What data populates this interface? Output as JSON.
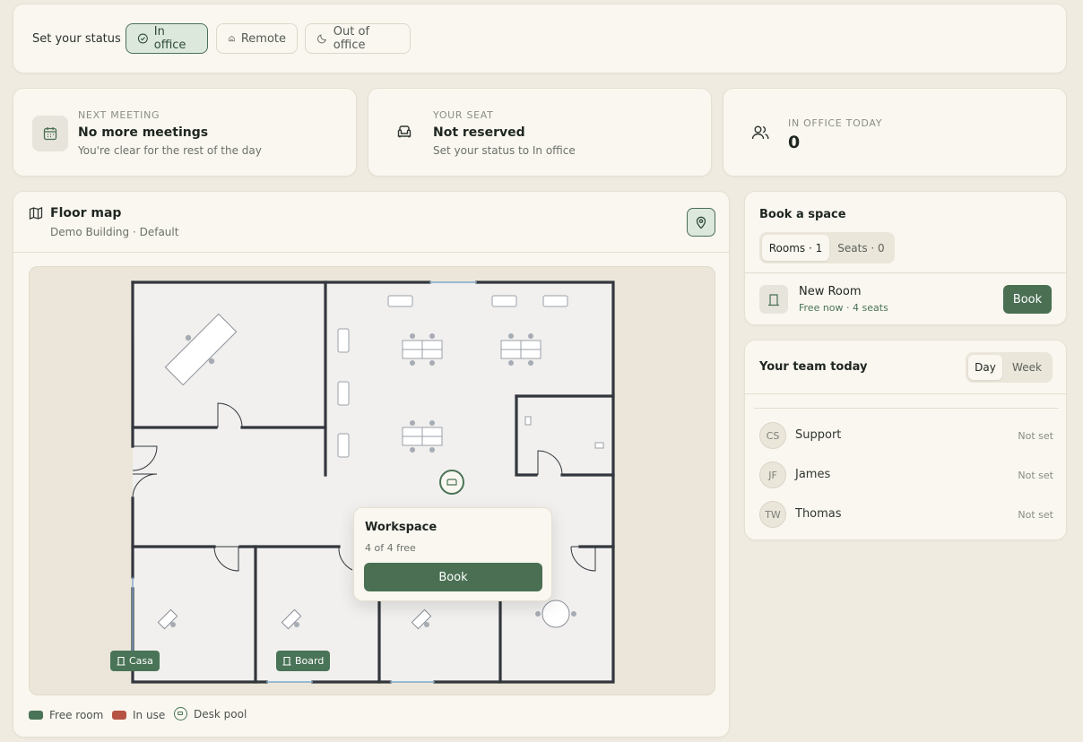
{
  "status": {
    "label": "Set your status",
    "options": [
      {
        "label": "In office",
        "icon": "check-circle-icon",
        "active": true
      },
      {
        "label": "Remote",
        "icon": "home-icon",
        "active": false
      },
      {
        "label": "Out of office",
        "icon": "moon-icon",
        "active": false
      }
    ]
  },
  "cards": {
    "meeting": {
      "kicker": "NEXT MEETING",
      "title": "No more meetings",
      "sub": "You're clear for the rest of the day",
      "icon": "calendar-icon"
    },
    "seat": {
      "kicker": "YOUR SEAT",
      "title": "Not reserved",
      "sub": "Set your status to In office",
      "icon": "armchair-icon"
    },
    "office": {
      "kicker": "IN OFFICE TODAY",
      "count": "0",
      "icon": "users-icon"
    }
  },
  "floor_map": {
    "title": "Floor map",
    "subtitle": "Demo Building · Default",
    "locate_icon": "map-pin-icon",
    "rooms": [
      {
        "name": "Casa",
        "state": "free"
      },
      {
        "name": "Board",
        "state": "free"
      }
    ],
    "popup": {
      "title": "Workspace",
      "availability": "4 of 4 free",
      "button": "Book"
    },
    "legend": [
      {
        "label": "Free room",
        "color": "#4a7457"
      },
      {
        "label": "In use",
        "color": "#b65343"
      },
      {
        "label": "Desk pool",
        "color": "#4a7457"
      }
    ]
  },
  "booking": {
    "title": "Book a space",
    "tabs": [
      {
        "label": "Rooms · 1",
        "active": true
      },
      {
        "label": "Seats · 0",
        "active": false
      }
    ],
    "room": {
      "name": "New Room",
      "detail": "Free now · 4 seats",
      "button": "Book"
    }
  },
  "team": {
    "title": "Your team today",
    "views": [
      {
        "label": "Day",
        "active": true
      },
      {
        "label": "Week",
        "active": false
      }
    ],
    "members": [
      {
        "initials": "CS",
        "name": "Support",
        "status": "Not set"
      },
      {
        "initials": "JF",
        "name": "James",
        "status": "Not set"
      },
      {
        "initials": "TW",
        "name": "Thomas",
        "status": "Not set"
      }
    ]
  },
  "colors": {
    "accent": "#4a6f53",
    "free": "#4a7457",
    "in_use": "#b65343",
    "background": "#efebe1"
  }
}
